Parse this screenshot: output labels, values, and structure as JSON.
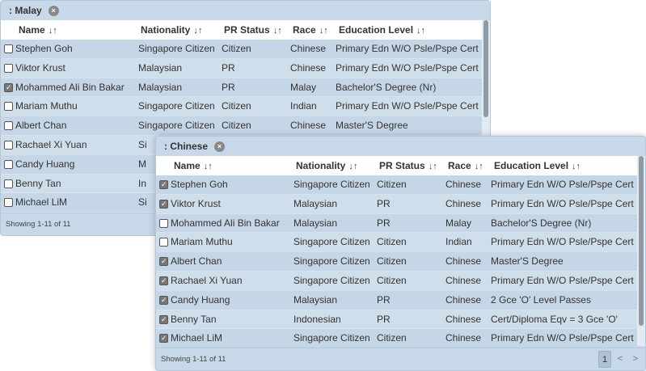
{
  "panels": [
    {
      "title": ": Malay",
      "remove_icon": "×",
      "columns": [
        "Name",
        "Nationality",
        "PR Status",
        "Race",
        "Education Level"
      ],
      "sort_icon": "↓↑",
      "rows": [
        {
          "checked": false,
          "name": "Stephen Goh",
          "nationality": "Singapore Citizen",
          "pr_status": "Citizen",
          "race": "Chinese",
          "education": "Primary Edn W/O Psle/Pspe Cert"
        },
        {
          "checked": false,
          "name": "Viktor Krust",
          "nationality": "Malaysian",
          "pr_status": "PR",
          "race": "Chinese",
          "education": "Primary Edn W/O Psle/Pspe Cert"
        },
        {
          "checked": true,
          "name": "Mohammed Ali Bin Bakar",
          "nationality": "Malaysian",
          "pr_status": "PR",
          "race": "Malay",
          "education": "Bachelor'S Degree (Nr)"
        },
        {
          "checked": false,
          "name": "Mariam Muthu",
          "nationality": "Singapore Citizen",
          "pr_status": "Citizen",
          "race": "Indian",
          "education": "Primary Edn W/O Psle/Pspe Cert"
        },
        {
          "checked": false,
          "name": "Albert Chan",
          "nationality": "Singapore Citizen",
          "pr_status": "Citizen",
          "race": "Chinese",
          "education": "Master'S Degree"
        },
        {
          "checked": false,
          "name": "Rachael Xi Yuan",
          "nationality": "Si",
          "pr_status": "",
          "race": "",
          "education": ""
        },
        {
          "checked": false,
          "name": "Candy Huang",
          "nationality": "M",
          "pr_status": "",
          "race": "",
          "education": ""
        },
        {
          "checked": false,
          "name": "Benny Tan",
          "nationality": "In",
          "pr_status": "",
          "race": "",
          "education": ""
        },
        {
          "checked": false,
          "name": "Michael LiM",
          "nationality": "Si",
          "pr_status": "",
          "race": "",
          "education": ""
        }
      ],
      "showing": "Showing 1-11 of 11"
    },
    {
      "title": ": Chinese",
      "remove_icon": "×",
      "columns": [
        "Name",
        "Nationality",
        "PR Status",
        "Race",
        "Education Level"
      ],
      "sort_icon": "↓↑",
      "rows": [
        {
          "checked": true,
          "name": "Stephen Goh",
          "nationality": "Singapore Citizen",
          "pr_status": "Citizen",
          "race": "Chinese",
          "education": "Primary Edn W/O Psle/Pspe Cert"
        },
        {
          "checked": true,
          "name": "Viktor Krust",
          "nationality": "Malaysian",
          "pr_status": "PR",
          "race": "Chinese",
          "education": "Primary Edn W/O Psle/Pspe Cert"
        },
        {
          "checked": false,
          "name": "Mohammed Ali Bin Bakar",
          "nationality": "Malaysian",
          "pr_status": "PR",
          "race": "Malay",
          "education": "Bachelor'S Degree (Nr)"
        },
        {
          "checked": false,
          "name": "Mariam Muthu",
          "nationality": "Singapore Citizen",
          "pr_status": "Citizen",
          "race": "Indian",
          "education": "Primary Edn W/O Psle/Pspe Cert"
        },
        {
          "checked": true,
          "name": "Albert Chan",
          "nationality": "Singapore Citizen",
          "pr_status": "Citizen",
          "race": "Chinese",
          "education": "Master'S Degree"
        },
        {
          "checked": true,
          "name": "Rachael Xi Yuan",
          "nationality": "Singapore Citizen",
          "pr_status": "Citizen",
          "race": "Chinese",
          "education": "Primary Edn W/O Psle/Pspe Cert"
        },
        {
          "checked": true,
          "name": "Candy Huang",
          "nationality": "Malaysian",
          "pr_status": "PR",
          "race": "Chinese",
          "education": "2 Gce 'O' Level Passes"
        },
        {
          "checked": true,
          "name": "Benny Tan",
          "nationality": "Indonesian",
          "pr_status": "PR",
          "race": "Chinese",
          "education": "Cert/Diploma Eqv = 3 Gce 'O'"
        },
        {
          "checked": true,
          "name": "Michael LiM",
          "nationality": "Singapore Citizen",
          "pr_status": "Citizen",
          "race": "Chinese",
          "education": "Primary Edn W/O Psle/Pspe Cert"
        }
      ],
      "showing": "Showing 1-11 of 11",
      "pager": {
        "current_page": "1",
        "prev": "<",
        "next": ">"
      }
    }
  ]
}
